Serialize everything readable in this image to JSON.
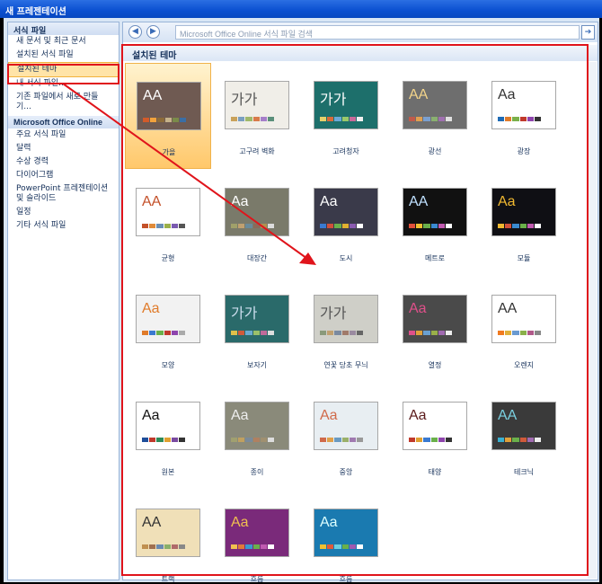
{
  "window": {
    "title": "새 프레젠테이션"
  },
  "sidebar": {
    "header": "서식 파일",
    "items": [
      {
        "label": "새 문서 및 최근 문서"
      },
      {
        "label": "설치된 서식 파일"
      },
      {
        "label": "설치된 테마",
        "selected": true
      },
      {
        "label": "내 서식 파일..."
      },
      {
        "label": "기존 파일에서 새로 만들기..."
      }
    ],
    "online_header": "Microsoft Office Online",
    "online_items": [
      {
        "label": "주요 서식 파일"
      },
      {
        "label": "달력"
      },
      {
        "label": "수상 경력"
      },
      {
        "label": "다이어그램"
      },
      {
        "label": "PowerPoint 프레젠테이션 및 슬라이드"
      },
      {
        "label": "일정"
      },
      {
        "label": "기타 서식 파일"
      }
    ]
  },
  "toolbar": {
    "search_placeholder": "Microsoft Office Online 서식 파일 검색",
    "back_icon": "back-arrow-icon",
    "forward_icon": "forward-arrow-icon",
    "go_icon": "go-arrow-icon"
  },
  "main": {
    "section_title": "설치된 테마",
    "themes": [
      {
        "name": "가을",
        "aa": "AA",
        "bg": "#6f5a52",
        "fg": "#ffffff",
        "selected": true,
        "sw": [
          "#d25b2a",
          "#f2a23c",
          "#8c6b3a",
          "#c6b28a",
          "#7a8b4a",
          "#3a6ea5"
        ]
      },
      {
        "name": "고구려 벽화",
        "aa": "가가",
        "bg": "#f0eee8",
        "fg": "#555",
        "sw": [
          "#c9a25a",
          "#7a9fc0",
          "#a0b86a",
          "#d87a4a",
          "#a67ec9",
          "#5a8f7a"
        ]
      },
      {
        "name": "고려청자",
        "aa": "가가",
        "bg": "#1d6f6b",
        "fg": "#fff",
        "sw": [
          "#e6d06a",
          "#d86a3a",
          "#6aa9d8",
          "#9ac86a",
          "#c86a9a",
          "#f0f0f0"
        ]
      },
      {
        "name": "광선",
        "aa": "AA",
        "bg": "#6e6e6e",
        "fg": "#f3d48a",
        "sw": [
          "#c05a4a",
          "#e0a050",
          "#7aa0d0",
          "#8ab070",
          "#a070b0",
          "#e0e0e0"
        ]
      },
      {
        "name": "광장",
        "aa": "Aa",
        "bg": "#ffffff",
        "fg": "#333",
        "sw": [
          "#1f6bb5",
          "#e07b2a",
          "#7ab04a",
          "#c0392b",
          "#8e44ad",
          "#333"
        ]
      },
      {
        "name": "균형",
        "aa": "AA",
        "bg": "#fff",
        "fg": "#c4512a",
        "sw": [
          "#c4512a",
          "#e08b3a",
          "#6a8fb5",
          "#9ab04a",
          "#7a5ab0",
          "#555"
        ]
      },
      {
        "name": "대장간",
        "aa": "Aa",
        "bg": "#7a7a6a",
        "fg": "#fff",
        "sw": [
          "#a0a06a",
          "#c0a070",
          "#6a8a9a",
          "#8a6a5a",
          "#b09050",
          "#ddd"
        ]
      },
      {
        "name": "도시",
        "aa": "Aa",
        "bg": "#3a3a4a",
        "fg": "#fff",
        "sw": [
          "#3a7ad0",
          "#d0503a",
          "#6ab04a",
          "#e0b030",
          "#8a5ab0",
          "#fff"
        ]
      },
      {
        "name": "메트로",
        "aa": "AA",
        "bg": "#111111",
        "fg": "#bfe0ff",
        "sw": [
          "#e0503a",
          "#f0c030",
          "#6ab04a",
          "#3a8ad0",
          "#c05ab0",
          "#fff"
        ]
      },
      {
        "name": "모듈",
        "aa": "Aa",
        "bg": "#0f0f14",
        "fg": "#f0b830",
        "sw": [
          "#f0b830",
          "#d0503a",
          "#3a8ad0",
          "#6ab04a",
          "#c05ab0",
          "#fff"
        ]
      },
      {
        "name": "모양",
        "aa": "Aa",
        "bg": "#f2f2f2",
        "fg": "#e07b2a",
        "sw": [
          "#e07b2a",
          "#3a7ad0",
          "#6ab04a",
          "#c0392b",
          "#8e44ad",
          "#aaa"
        ]
      },
      {
        "name": "보자기",
        "aa": "가가",
        "bg": "#2a6a6a",
        "fg": "#cde",
        "sw": [
          "#e0c04a",
          "#d05a3a",
          "#6aaad0",
          "#9ac06a",
          "#c06a9a",
          "#ddd"
        ]
      },
      {
        "name": "연꽃 당초 무늬",
        "aa": "가가",
        "bg": "#cfcfc8",
        "fg": "#555",
        "sw": [
          "#8a9a7a",
          "#c0a070",
          "#7a8aa0",
          "#a07a6a",
          "#9a8aa0",
          "#666"
        ]
      },
      {
        "name": "열정",
        "aa": "Aa",
        "bg": "#4a4a4a",
        "fg": "#e0508a",
        "sw": [
          "#e0508a",
          "#e0a03a",
          "#6aa0d0",
          "#9ab04a",
          "#a06ab0",
          "#eee"
        ]
      },
      {
        "name": "오렌지",
        "aa": "AA",
        "bg": "#ffffff",
        "fg": "#333",
        "sw": [
          "#f07a20",
          "#e0b03a",
          "#6a9ad0",
          "#8ab04a",
          "#b05a8a",
          "#888"
        ]
      },
      {
        "name": "원본",
        "aa": "Aa",
        "bg": "#ffffff",
        "fg": "#111",
        "sw": [
          "#1f4e9a",
          "#c0392b",
          "#2e8b57",
          "#e0a030",
          "#7a4aa0",
          "#333"
        ]
      },
      {
        "name": "종이",
        "aa": "Aa",
        "bg": "#8a8a7a",
        "fg": "#eee",
        "sw": [
          "#a0a070",
          "#c0a060",
          "#7a8a9a",
          "#b08060",
          "#a09070",
          "#ddd"
        ]
      },
      {
        "name": "중앙",
        "aa": "Aa",
        "bg": "#e8eef2",
        "fg": "#d06a4a",
        "sw": [
          "#d06a4a",
          "#e0a04a",
          "#6a9ac0",
          "#9ab06a",
          "#a07ab0",
          "#999"
        ]
      },
      {
        "name": "태양",
        "aa": "Aa",
        "bg": "#ffffff",
        "fg": "#5a1a1a",
        "sw": [
          "#c0392b",
          "#e0a030",
          "#3a7ad0",
          "#6ab04a",
          "#8e44ad",
          "#333"
        ]
      },
      {
        "name": "테크닉",
        "aa": "AA",
        "bg": "#3a3a3a",
        "fg": "#7ad0e0",
        "sw": [
          "#3ab0d0",
          "#e0a03a",
          "#6ab04a",
          "#d05a3a",
          "#a06ab0",
          "#eee"
        ]
      },
      {
        "name": "트랙",
        "aa": "AA",
        "bg": "#f0e0b8",
        "fg": "#333",
        "sw": [
          "#c09050",
          "#a07050",
          "#6a8ab0",
          "#8ab06a",
          "#b06a6a",
          "#888"
        ]
      },
      {
        "name": "흐름",
        "aa": "Aa",
        "bg": "#7a2a7a",
        "fg": "#f0c050",
        "sw": [
          "#f0c050",
          "#e07a3a",
          "#3a9ad0",
          "#6ab04a",
          "#c05ab0",
          "#fff"
        ]
      },
      {
        "name": "흐름",
        "aa": "Aa",
        "bg": "#1a7ab0",
        "fg": "#dff",
        "sw": [
          "#f0c030",
          "#e05a3a",
          "#6ad0e0",
          "#6ab04a",
          "#a05ab0",
          "#fff"
        ]
      }
    ]
  }
}
